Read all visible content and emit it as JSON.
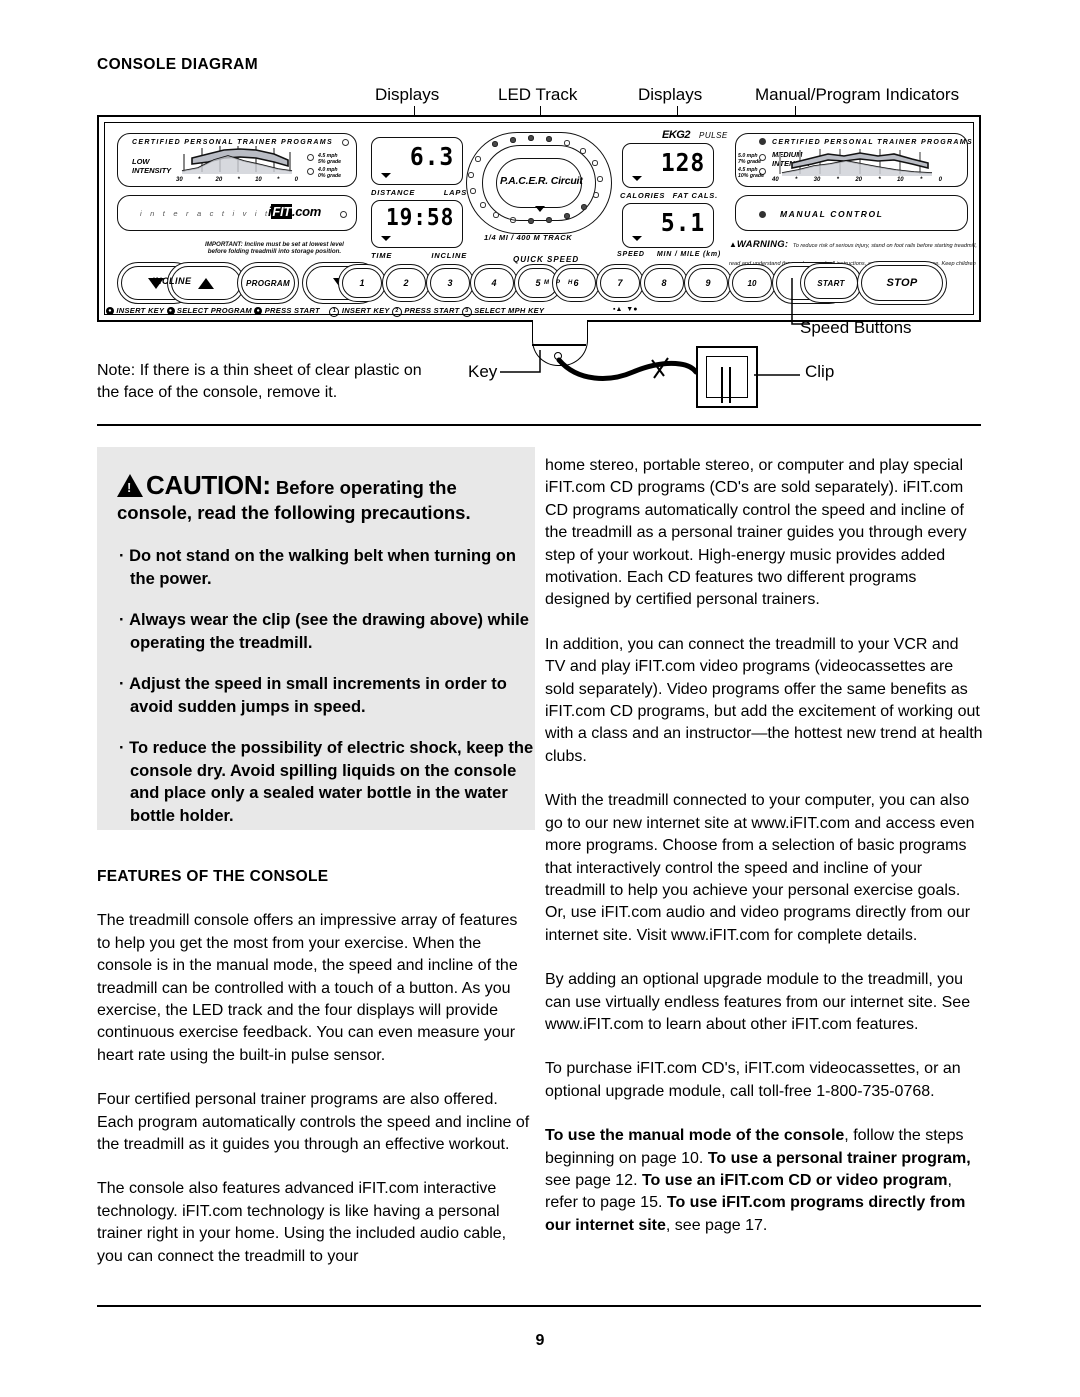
{
  "section": {
    "title": "CONSOLE DIAGRAM"
  },
  "callouts": {
    "displays_left": "Displays",
    "led_track": "LED Track",
    "displays_right": "Displays",
    "manual_program_indicators": "Manual/Program Indicators",
    "speed_buttons": "Speed Buttons",
    "key": "Key",
    "clip": "Clip"
  },
  "console": {
    "program_panel_left": {
      "title": "CERTIFIED PERSONAL TRAINER PROGRAMS",
      "intensity": "LOW\nINTENSITY",
      "axis_labels": [
        "30",
        "*",
        "20",
        "*",
        "10",
        "*",
        "0"
      ],
      "speed_tags": [
        "4.5 mph\n5% grade",
        "4.0 mph\n0% grade"
      ]
    },
    "program_panel_right": {
      "title": "CERTIFIED PERSONAL TRAINER PROGRAMS",
      "intensity": "MEDIUM\nINTENSITY",
      "axis_labels": [
        "40",
        "*",
        "30",
        "*",
        "20",
        "*",
        "10",
        "*",
        "0"
      ],
      "speed_tags": [
        "5.0 mph\n7% grade",
        "4.5 mph\n10% grade"
      ]
    },
    "interactivity_panel": {
      "word": "i n t e r a c t i v i t y",
      "logo_i": "i",
      "logo_fit": "FIT",
      "logo_com": ".com"
    },
    "manual_control": "MANUAL CONTROL",
    "displays": [
      {
        "value": "6.3",
        "left_label": "DISTANCE",
        "right_label": "LAPS"
      },
      {
        "value": "19:58",
        "left_label": "TIME",
        "right_label": "INCLINE"
      },
      {
        "value": "128",
        "left_label": "CALORIES",
        "right_label": "FAT CALS."
      },
      {
        "value": "5.1",
        "left_label": "SPEED",
        "right_label": "MIN / MILE (km)"
      }
    ],
    "ekg": {
      "label": "EKG2",
      "pulse": "PULSE"
    },
    "track": {
      "logo": "P.A.C.E.R. Circuit",
      "caption": "1/4 MI / 400 M TRACK"
    },
    "important_note": "IMPORTANT: Incline must be set at lowest level\nbefore folding treadmill into storage position.",
    "warning": {
      "word": "WARNING:",
      "body": "To reduce risk of serious injury, stand on foot rails before starting treadmill, read and understand the user's manual, all instructions, and the warnings before use.  Keep children away."
    },
    "buttons": {
      "incline": "INCLINE",
      "program": "PROGRAM",
      "numbers": [
        "1",
        "2",
        "3",
        "4",
        "5",
        "6",
        "7",
        "8",
        "9",
        "10"
      ],
      "quick_speed": "QUICK SPEED",
      "mph": [
        "M",
        "P",
        "H"
      ],
      "start": "START",
      "stop": "STOP"
    },
    "legend": {
      "step1": "INSERT KEY",
      "step2": "SELECT PROGRAM",
      "step3": "PRESS START",
      "alt1": "INSERT KEY",
      "alt2": "PRESS START",
      "alt3": "SELECT MPH KEY",
      "nums": [
        "1",
        "2",
        "3"
      ]
    }
  },
  "note": "Note: If there is a thin sheet of clear plastic on the face of the console, remove it.",
  "caution": {
    "word": "CAUTION:",
    "lead": " Before operating the console, read the following precautions.",
    "bullets": [
      "Do not stand on the walking belt when turning on the power.",
      "Always wear the clip (see the drawing above) while operating the treadmill.",
      "Adjust the speed in small increments in order to avoid sudden jumps in speed.",
      "To reduce the possibility of electric shock, keep the console dry. Avoid spilling liquids on the console and place only a sealed water bottle in the water bottle holder."
    ]
  },
  "features": {
    "heading": "FEATURES OF THE CONSOLE",
    "paragraphs": [
      "The treadmill console offers an impressive array of features to help you get the most from your exercise. When the console is in the manual mode, the speed and incline of the treadmill can be controlled with a touch of a button. As you exercise, the LED track and the four displays will provide continuous exercise feedback. You can even measure your heart rate using the built-in pulse sensor.",
      "Four certified personal trainer programs are also offered. Each program automatically controls the speed and incline of the treadmill as it guides you through an effective workout.",
      "The console also features advanced iFIT.com interactive technology. iFIT.com technology is like having a personal trainer right in your home. Using the included audio cable, you can connect the treadmill to your"
    ]
  },
  "right_column": {
    "paragraphs": [
      "home stereo, portable stereo, or computer and play special iFIT.com CD programs (CD's are sold separately). iFIT.com CD programs automatically control the speed and incline of the treadmill as a personal trainer guides you through every step of your workout. High-energy music provides added motivation. Each CD features two different programs designed by certified personal trainers.",
      "In addition, you can connect the treadmill to your VCR and TV and play iFIT.com video programs (videocassettes are sold separately). Video programs offer the same benefits as iFIT.com CD programs, but add the excitement of working out with a class and an instructor—the hottest new trend at health clubs.",
      "With the treadmill connected to your computer, you can also go to our new internet site at www.iFIT.com and access even more programs. Choose from a selection of basic programs that interactively control the speed and incline of your treadmill to help you achieve your personal exercise goals. Or, use iFIT.com audio and video programs directly from our internet site. Visit www.iFIT.com for complete details.",
      "By adding an optional upgrade module to the treadmill, you can use virtually endless features from our internet site. See www.iFIT.com to learn about other iFIT.com features.",
      "To purchase iFIT.com CD's, iFIT.com videocassettes, or an optional upgrade module, call toll-free 1-800-735-0768."
    ],
    "final_paragraph": {
      "b1": "To use the manual mode of the console",
      "t1": ", follow the steps beginning on page 10. ",
      "b2": "To use a personal trainer program,",
      "t2": " see page 12. ",
      "b3": "To use an iFIT.com CD or video program",
      "t3": ", refer to page 15. ",
      "b4": "To use iFIT.com programs directly from our internet site",
      "t4": ", see page 17."
    }
  },
  "page_number": "9"
}
